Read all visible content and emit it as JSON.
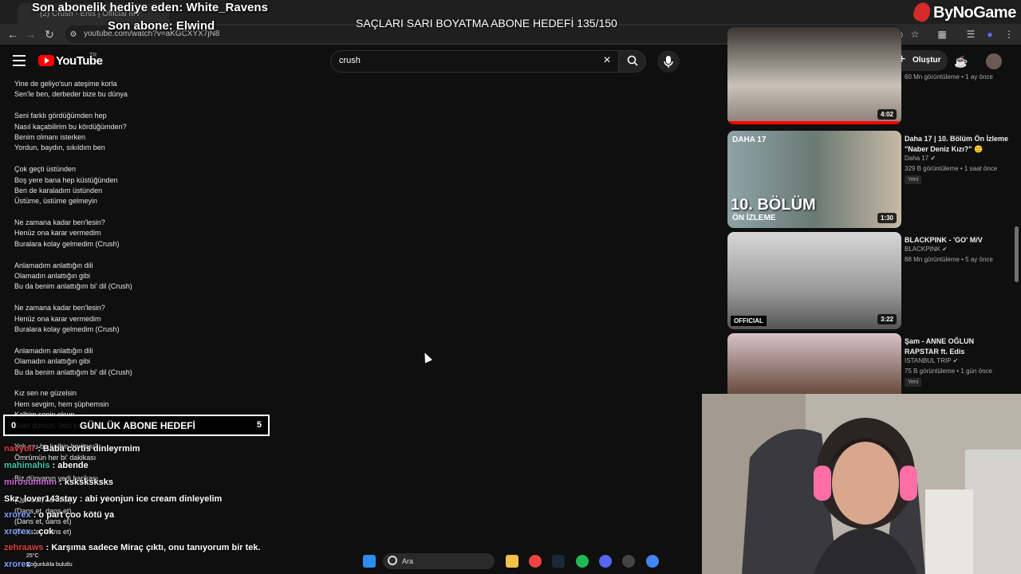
{
  "browser": {
    "tab_title": "(2) Crush - Enis | Official MV",
    "url": "youtube.com/watch?v=aKGCXYX7jN8"
  },
  "youtube": {
    "logo_text": "YouTube",
    "logo_sup": "TR",
    "search_value": "crush",
    "create_label": "Oluştur"
  },
  "lyrics": [
    "Yine de geliyo'sun ateşime korla",
    "Sen'le ben, derbeder bize bu dünya",
    "",
    "Seni farklı gördüğümden hep",
    "Nasıl kaçabilirim bu kördüğümden?",
    "Benim olmanı isterken",
    "Yordun, baydın, sıkıldım ben",
    "",
    "Çok geçti üstünden",
    "Boş yere bana hep küstüğünden",
    "Ben de karaladım üstünden",
    "Üstüme, üstüme gelmeyin",
    "",
    "Ne zamana kadar ben'lesin?",
    "Henüz ona karar vermedim",
    "Buralara kolay gelmedim (Crush)",
    "",
    "Anlamadım anlattığın dili",
    "Olamadın anlattığın gibi",
    "Bu da benim anlattığım bi' dil (Crush)",
    "",
    "Ne zamana kadar ben'lesin?",
    "Henüz ona karar vermedim",
    "Buralara kolay gelmedim (Crush)",
    "",
    "Anlamadım anlattığın dili",
    "Olamadın anlattığın gibi",
    "Bu da benim anlattığım bi' dil (Crush)",
    "",
    "Kız sen ne güzelsin",
    "Hem sevgim, hem şüphemsin",
    "Kalbim senin olsun",
    "Saklı dursun, üstü kalsın",
    "",
    "Yok mu bu kalbin haritası?",
    "Ömrümün her bi' dakikası",
    "",
    "Biz dünyanın yedi harikası",
    "",
    "(Dans et, dans et)",
    "(Dans et, dans et)",
    "(Dans et, dans et)",
    "(Dans et, dans et)"
  ],
  "sidebar": [
    {
      "title": "",
      "channel": "",
      "meta": "60 Mn görüntüleme • 1 ay önce",
      "duration": "4:02",
      "badge": ""
    },
    {
      "title": "Daha 17 | 10. Bölüm Ön İzleme \"Naber Deniz Kızı?\" 🙂",
      "channel": "Daha 17",
      "meta": "329 B görüntüleme • 1 saat önce",
      "duration": "1:30",
      "badge": "Yeni",
      "thumb_text1": "DAHA 17",
      "thumb_text2": "10. BÖLÜM",
      "thumb_text3": "ÖN İZLEME"
    },
    {
      "title": "BLACKPINK - 'GO' M/V",
      "channel": "BLACKPINK",
      "meta": "88 Mn görüntüleme • 5 ay önce",
      "duration": "3:22",
      "badge": "",
      "thumb_text1": "OFFICIAL"
    },
    {
      "title": "Şam - ANNE OĞLUN RAPSTAR ft. Edis",
      "channel": "ISTANBUL TRIP",
      "meta": "75 B görüntüleme • 1 gün önce",
      "duration": "",
      "badge": "Yeni"
    }
  ],
  "overlay": {
    "donor_text": "Son abonelik hediye eden: White_Ravens",
    "last_sub_text": "Son abone: Elwind",
    "goal_text": "SAÇLARI SARI BOYATMA ABONE HEDEFİ 135/150",
    "brand": "ByNoGame",
    "daily_goal": {
      "left": "0",
      "title": "GÜNLÜK ABONE HEDEFİ",
      "right": "5"
    }
  },
  "chat": [
    {
      "user": "navyolr",
      "message": "Baba cörtis dinleyrmim",
      "color": "#e04040"
    },
    {
      "user": "mahimahis",
      "message": "abende",
      "color": "#3fc7a8"
    },
    {
      "user": "mirosummm",
      "message": "ksksksksks",
      "color": "#d06ad8"
    },
    {
      "user": "Skz_lover143stay",
      "message": "abi yeonjun ice cream dinleyelim",
      "color": "#ffffff"
    },
    {
      "user": "xrorex",
      "message": "o part çoo kötü ya",
      "color": "#7fa0ff"
    },
    {
      "user": "xrorex",
      "message": "çok",
      "color": "#7fa0ff"
    },
    {
      "user": "zehraaws",
      "message": "Karşıma sadece Miraç çıktı, onu tanıyorum bir tek.",
      "color": "#e04040"
    },
    {
      "user": "xrorex",
      "message": "",
      "color": "#7fa0ff"
    }
  ],
  "taskbar": {
    "weather_temp": "25°C",
    "weather_desc": "Çoğunlukla bulutlu",
    "search_placeholder": "Ara"
  }
}
